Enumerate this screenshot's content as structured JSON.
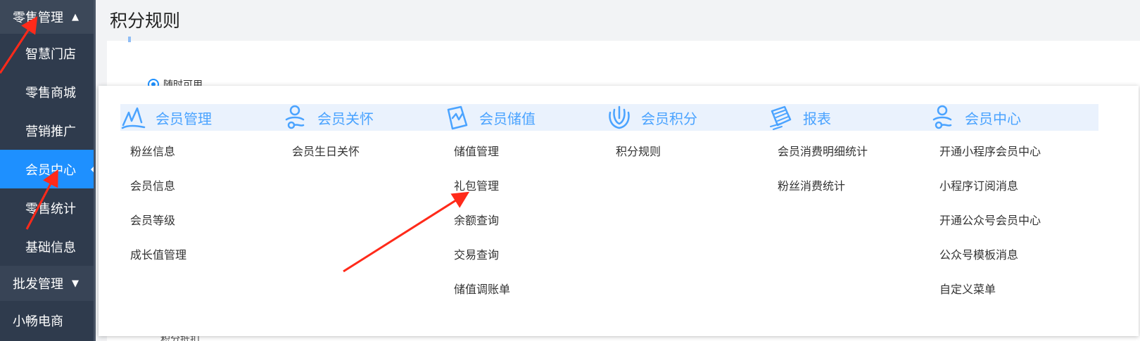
{
  "sidebar": {
    "group_retail": {
      "label": "零售管理",
      "caret": "▲"
    },
    "items": [
      {
        "label": "智慧门店"
      },
      {
        "label": "零售商城"
      },
      {
        "label": "营销推广"
      },
      {
        "label": "会员中心",
        "active": true
      },
      {
        "label": "零售统计"
      },
      {
        "label": "基础信息"
      }
    ],
    "group_wholesale": {
      "label": "批发管理",
      "caret": "▼"
    },
    "xiaochang": {
      "label": "小畅电商"
    }
  },
  "page": {
    "title": "积分规则",
    "radio_label": "随时可用",
    "bottom_fragment": "积分抵扣"
  },
  "menu": {
    "columns": [
      {
        "title": "会员管理",
        "icon": "member-manage-icon",
        "items": [
          "粉丝信息",
          "会员信息",
          "会员等级",
          "成长值管理"
        ]
      },
      {
        "title": "会员关怀",
        "icon": "member-care-icon",
        "items": [
          "会员生日关怀"
        ]
      },
      {
        "title": "会员储值",
        "icon": "member-deposit-icon",
        "items": [
          "储值管理",
          "礼包管理",
          "余额查询",
          "交易查询",
          "储值调账单"
        ]
      },
      {
        "title": "会员积分",
        "icon": "member-points-icon",
        "items": [
          "积分规则"
        ]
      },
      {
        "title": "报表",
        "icon": "report-icon",
        "items": [
          "会员消费明细统计",
          "粉丝消费统计"
        ]
      },
      {
        "title": "会员中心",
        "icon": "member-center-icon",
        "items": [
          "开通小程序会员中心",
          "小程序订阅消息",
          "开通公众号会员中心",
          "公众号模板消息",
          "自定义菜单"
        ]
      }
    ]
  },
  "colors": {
    "sidebar_bg": "#2f3b4d",
    "active_bg": "#1e90ff",
    "menu_head_bg": "#eaf2fd",
    "menu_head_text": "#4aa3ff",
    "annotation_red": "#ff2a1a"
  }
}
